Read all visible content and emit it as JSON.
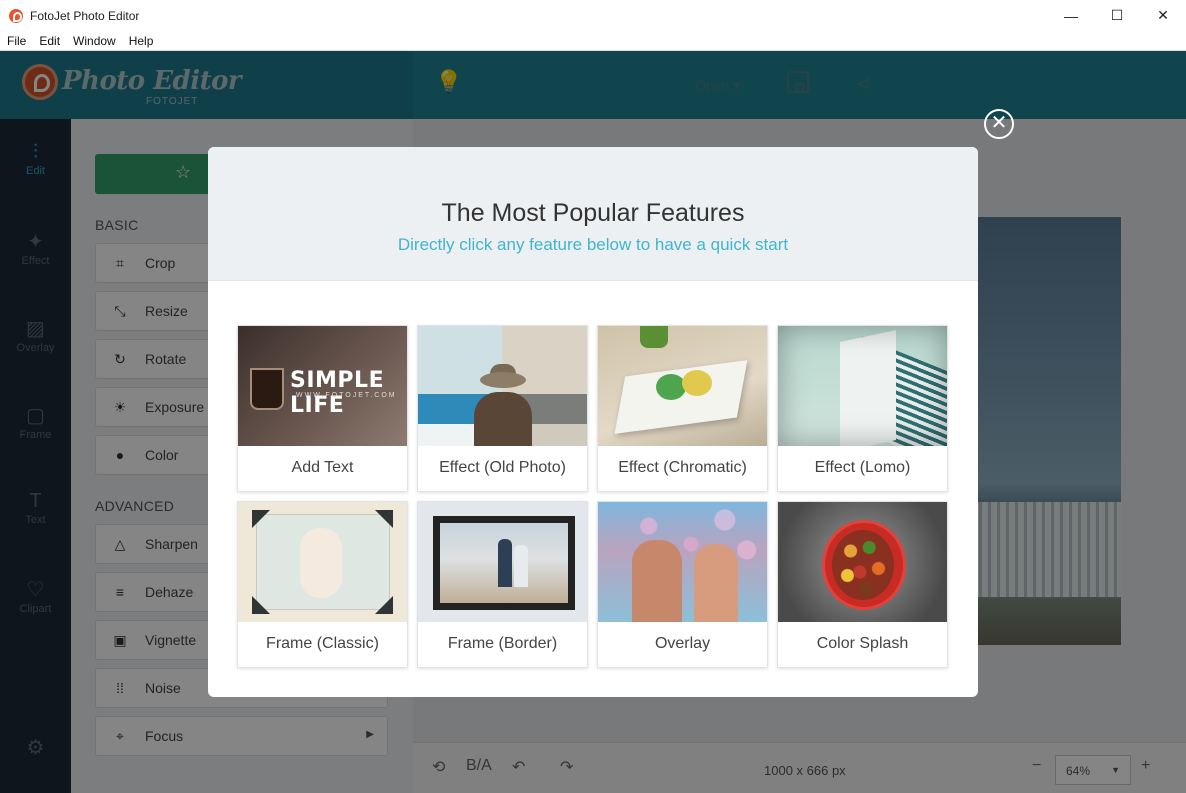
{
  "window": {
    "title": "FotoJet Photo Editor",
    "min_icon": "minimize-icon",
    "max_icon": "maximize-icon",
    "close_icon": "close-icon"
  },
  "menu": [
    "File",
    "Edit",
    "Window",
    "Help"
  ],
  "header": {
    "logo_text": "Photo Editor",
    "logo_sub": "FOTOJET",
    "open_label": "Open ▾"
  },
  "sidebar": {
    "items": [
      {
        "label": "Edit",
        "icon": "sliders-icon"
      },
      {
        "label": "Effect",
        "icon": "magic-wand-icon"
      },
      {
        "label": "Overlay",
        "icon": "overlay-icon"
      },
      {
        "label": "Frame",
        "icon": "frame-icon"
      },
      {
        "label": "Text",
        "icon": "text-icon"
      },
      {
        "label": "Clipart",
        "icon": "heart-icon"
      }
    ]
  },
  "panel": {
    "basic_title": "BASIC",
    "advanced_title": "ADVANCED",
    "basic": [
      "Crop",
      "Resize",
      "Rotate",
      "Exposure",
      "Color"
    ],
    "advanced": [
      "Sharpen",
      "Dehaze",
      "Vignette",
      "Noise",
      "Focus"
    ]
  },
  "bottom": {
    "dims": "1000 x 666 px",
    "zoom": "64%"
  },
  "modal": {
    "title": "The Most Popular Features",
    "subtitle": "Directly click any feature below to have a quick start",
    "add_text_overlay": "SIMPLE LIFE",
    "add_text_overlay_sub": "WWW.FOTOJET.COM",
    "features": [
      "Add Text",
      "Effect (Old Photo)",
      "Effect (Chromatic)",
      "Effect (Lomo)",
      "Frame (Classic)",
      "Frame (Border)",
      "Overlay",
      "Color Splash"
    ]
  },
  "colors": {
    "header": "#1f8496",
    "sidebar": "#1c2a36",
    "accent": "#3fb5d3",
    "auto_button": "#33a068"
  }
}
